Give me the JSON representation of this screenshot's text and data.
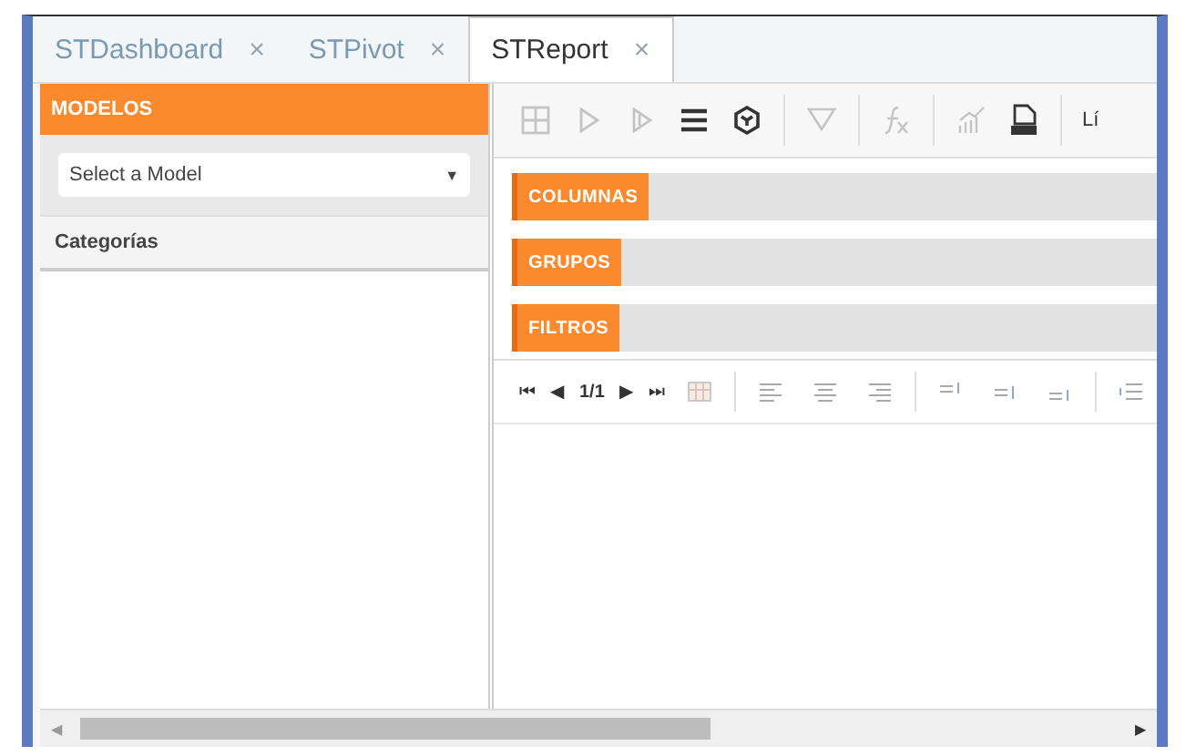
{
  "tabs": [
    {
      "label": "STDashboard",
      "close": "×",
      "selected": false
    },
    {
      "label": "STPivot",
      "close": "×",
      "selected": false
    },
    {
      "label": "STReport",
      "close": "×",
      "selected": true
    }
  ],
  "sidebar": {
    "header": "MODELOS",
    "model_select": {
      "placeholder": "Select a Model",
      "arrow": "▼"
    },
    "section": "Categorías"
  },
  "toolbar": [
    {
      "kind": "grid",
      "disabled": true
    },
    {
      "kind": "play",
      "disabled": true
    },
    {
      "kind": "step",
      "disabled": true
    },
    {
      "kind": "menu",
      "disabled": false
    },
    {
      "kind": "cube",
      "disabled": false
    },
    {
      "kind": "sep"
    },
    {
      "kind": "filter",
      "disabled": true
    },
    {
      "kind": "sep"
    },
    {
      "kind": "fx",
      "disabled": true
    },
    {
      "kind": "sep"
    },
    {
      "kind": "chart",
      "disabled": true
    },
    {
      "kind": "pdf",
      "disabled": false
    },
    {
      "kind": "sep"
    },
    {
      "kind": "text",
      "label": "Lí"
    }
  ],
  "drop_zones": [
    {
      "label": "COLUMNAS"
    },
    {
      "label": "GRUPOS"
    },
    {
      "label": "FILTROS"
    }
  ],
  "pager": {
    "first": "⏮",
    "prev": "◀",
    "page": "1/1",
    "next": "▶",
    "last": "⏭"
  },
  "format_toolbar": [
    {
      "kind": "table"
    },
    {
      "kind": "sep"
    },
    {
      "kind": "align-left"
    },
    {
      "kind": "align-center"
    },
    {
      "kind": "align-right"
    },
    {
      "kind": "sep"
    },
    {
      "kind": "valign-top"
    },
    {
      "kind": "valign-middle"
    },
    {
      "kind": "valign-bottom"
    },
    {
      "kind": "sep"
    },
    {
      "kind": "wrap"
    }
  ],
  "scrollbar": {
    "left": "◀",
    "right": "▶"
  }
}
